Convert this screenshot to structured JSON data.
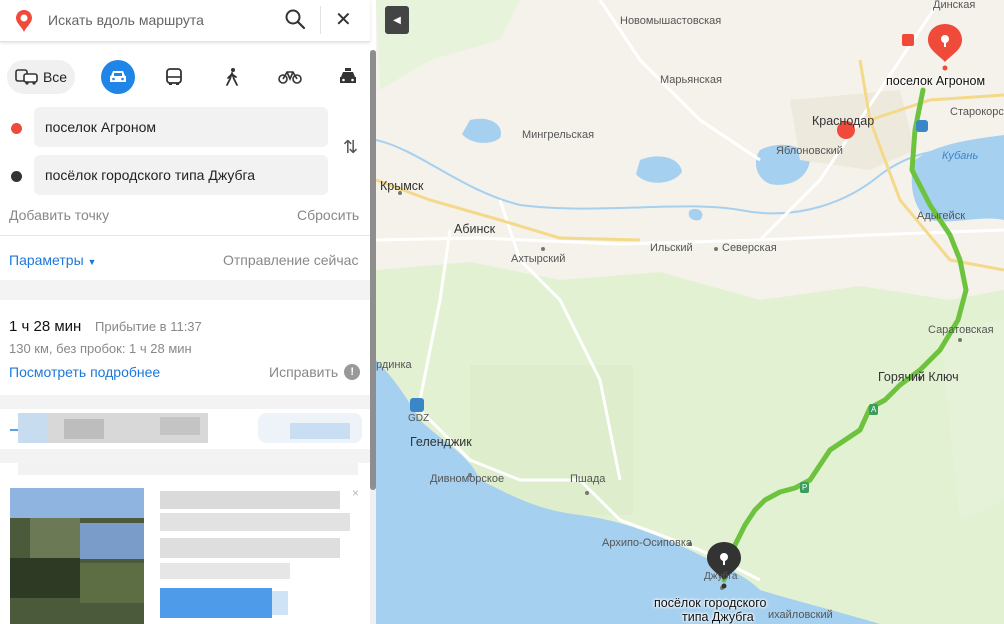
{
  "search": {
    "placeholder": "Искать вдоль маршрута"
  },
  "modes": {
    "all_label": "Все"
  },
  "route": {
    "from": "поселок Агроном",
    "to": "посёлок городского типа Джубга",
    "add_point": "Добавить точку",
    "reset": "Сбросить",
    "params": "Параметры",
    "departure": "Отправление сейчас"
  },
  "summary": {
    "duration": "1 ч 28 мин",
    "arrival": "Прибытие в 11:37",
    "distance": "130 км, без пробок: 1 ч 28 мин",
    "details_link": "Посмотреть подробнее",
    "fix_link": "Исправить"
  },
  "map": {
    "labels": {
      "dinskaya": "Динская",
      "novomyshastovskaya": "Новомышастовская",
      "maryanskaya": "Марьянская",
      "starokorsunskaya": "Старокорс",
      "krasnodar": "Краснодар",
      "mingrelskaya": "Мингрельская",
      "yablonovsky": "Яблоновский",
      "kuban": "Кубань",
      "krymsk": "Крымск",
      "adygeysk": "Адыгейск",
      "abinsk": "Абинск",
      "ilsky": "Ильский",
      "severskaya": "Северская",
      "akhtyrsky": "Ахтырский",
      "saratovskaya": "Саратовская",
      "kabardinka": "рдинка",
      "goryachy_klyuch": "Горячий Ключ",
      "gdz": "GDZ",
      "gelendzhik": "Геленджик",
      "divnomorskoe": "Дивноморское",
      "pshada": "Пшада",
      "arkhipo_osipovka": "Архипо-Осиповка",
      "dzhubga_small": "Джубга",
      "mikhaylovsky": "ихайловский",
      "road_a": "A",
      "road_r": "Р"
    },
    "start_pin_label": "поселок Агроном",
    "end_pin_label_1": "посёлок городского",
    "end_pin_label_2": "типа Джубга"
  },
  "colors": {
    "accent": "#1f85e6",
    "route": "#6dc23e",
    "start": "#f04a3a",
    "end": "#333333",
    "water": "#a6d0ef",
    "forest": "#dff0cf"
  }
}
